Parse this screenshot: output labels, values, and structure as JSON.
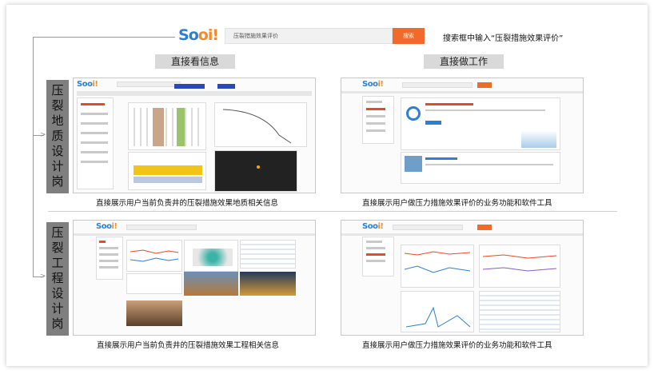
{
  "search": {
    "placeholder_text": "压裂措施效果评价",
    "button_label": "搜索",
    "instruction": "搜索框中输入“压裂措施效果评价”"
  },
  "logo": {
    "text_s": "S",
    "text_o1": "o",
    "text_o2": "o",
    "text_rest": "i!"
  },
  "columns": {
    "left_header": "直接看信息",
    "right_header": "直接做工作"
  },
  "rows": [
    {
      "label": [
        "压",
        "裂",
        "地",
        "质",
        "设",
        "计",
        "岗"
      ]
    },
    {
      "label": [
        "压",
        "裂",
        "工",
        "程",
        "设",
        "计",
        "岗"
      ]
    }
  ],
  "captions": {
    "geo_info": "直接展示用户当前负责井的压裂措施效果地质相关信息",
    "geo_work": "直接展示用户做压力措施效果评价的业务功能和软件工具",
    "eng_info": "直接展示用户当前负责井的压裂措施效果工程相关信息",
    "eng_work": "直接展示用户做压力措施效果评价的业务功能和软件工具"
  },
  "colors": {
    "accent_orange": "#f06a2b",
    "logo_blue": "#2d7fd3",
    "side_gray": "#7f7f7f",
    "pill_gray": "#d9d9d9"
  }
}
